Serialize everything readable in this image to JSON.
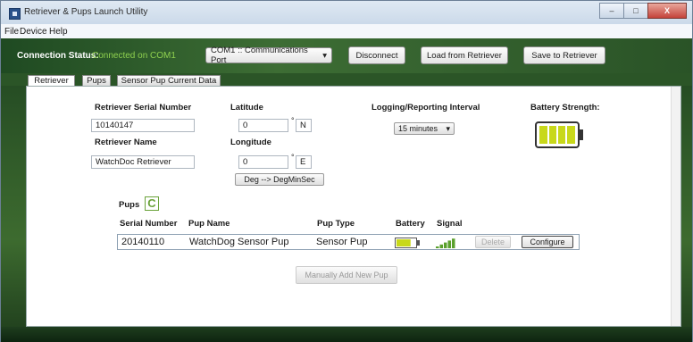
{
  "window": {
    "title": "Retriever & Pups Launch Utility",
    "controls": {
      "minimize": "–",
      "maximize": "□",
      "close": "X"
    }
  },
  "menu": [
    "File",
    "Device",
    "Help"
  ],
  "connection": {
    "label": "Connection Status:",
    "status": "Connected on COM1",
    "port_value": "COM1 :: Communications Port",
    "disconnect": "Disconnect",
    "load": "Load from Retriever",
    "save": "Save to Retriever"
  },
  "tabs": [
    "Retriever",
    "Pups",
    "Sensor Pup Current Data"
  ],
  "retriever": {
    "serial_label": "Retriever Serial Number",
    "serial_value": "10140147",
    "name_label": "Retriever Name",
    "name_value": "WatchDoc Retriever",
    "latitude_label": "Latitude",
    "latitude_value": "0",
    "lat_hemisphere": "N",
    "longitude_label": "Longitude",
    "longitude_value": "0",
    "lon_hemisphere": "E",
    "deg_button": "Deg --> DegMinSec",
    "interval_label": "Logging/Reporting Interval",
    "interval_value": "15 minutes",
    "battery_label": "Battery Strength:",
    "battery_level": 1.0
  },
  "pups": {
    "label": "Pups",
    "columns": [
      "Serial Number",
      "Pup Name",
      "Pup Type",
      "Battery",
      "Signal"
    ],
    "rows": [
      {
        "serial": "20140110",
        "name": "WatchDog Sensor Pup",
        "type": "Sensor Pup",
        "battery_level": 0.75,
        "signal_level": 1.0,
        "delete": "Delete",
        "configure": "Configure"
      }
    ],
    "add_button": "Manually Add New Pup"
  },
  "colors": {
    "accent_green": "#8fd14f",
    "battery_yellow": "#c8d81a"
  }
}
